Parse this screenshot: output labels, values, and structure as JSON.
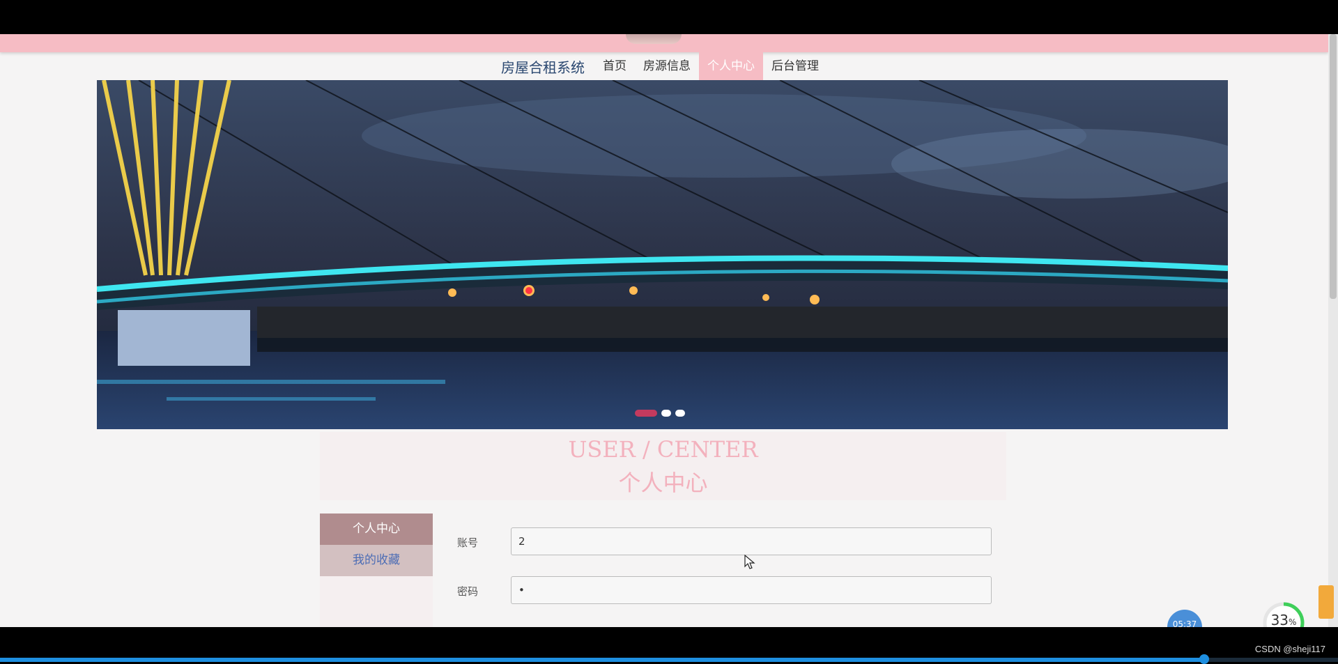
{
  "nav": {
    "brand": "房屋合租系统",
    "items": [
      {
        "label": "首页",
        "active": false
      },
      {
        "label": "房源信息",
        "active": false
      },
      {
        "label": "个人中心",
        "active": true
      },
      {
        "label": "后台管理",
        "active": false
      }
    ]
  },
  "carousel": {
    "slide_count": 3,
    "active_index": 0
  },
  "center_header": {
    "title_en": "USER / CENTER",
    "title_cn": "个人中心"
  },
  "sidebar": {
    "items": [
      "个人中心",
      "我的收藏"
    ]
  },
  "form": {
    "fields": [
      {
        "label": "账号",
        "value": "2"
      },
      {
        "label": "密码",
        "value": "•"
      }
    ]
  },
  "overlay": {
    "time": "05:37",
    "percent": "33",
    "percent_unit": "%",
    "watermark": "CSDN @sheji117",
    "video_progress": 0.9
  },
  "colors": {
    "accent_pink": "#f6bcc4",
    "brand_blue": "#2a4770",
    "progress_blue": "#1e8fe0"
  }
}
